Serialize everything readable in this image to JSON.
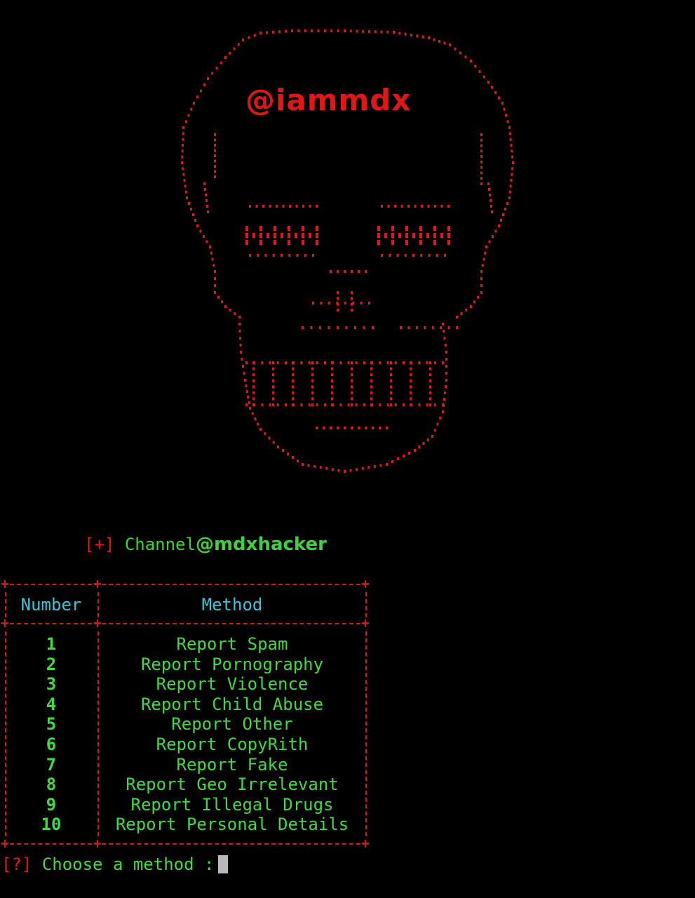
{
  "banner": {
    "handle": "@iammdx",
    "color": "#e11717"
  },
  "channel": {
    "bracket_open": "[",
    "plus": "+",
    "bracket_close": "]",
    "label": "Channel",
    "handle": "@mdxhacker"
  },
  "table": {
    "headers": {
      "number": "Number",
      "method": "Method"
    },
    "rows": [
      {
        "number": "1",
        "method": "Report Spam"
      },
      {
        "number": "2",
        "method": "Report Pornography"
      },
      {
        "number": "3",
        "method": "Report Violence"
      },
      {
        "number": "4",
        "method": "Report Child Abuse"
      },
      {
        "number": "5",
        "method": "Report Other"
      },
      {
        "number": "6",
        "method": "Report CopyRith"
      },
      {
        "number": "7",
        "method": "Report Fake"
      },
      {
        "number": "8",
        "method": "Report Geo Irrelevant"
      },
      {
        "number": "9",
        "method": "Report Illegal Drugs"
      },
      {
        "number": "10",
        "method": "Report Personal Details"
      }
    ]
  },
  "prompt": {
    "marker": "[?]",
    "text": "Choose a method :",
    "value": ""
  },
  "colors": {
    "background": "#000000",
    "red": "#e11717",
    "green": "#44d944",
    "cyan": "#3fc6d6"
  }
}
